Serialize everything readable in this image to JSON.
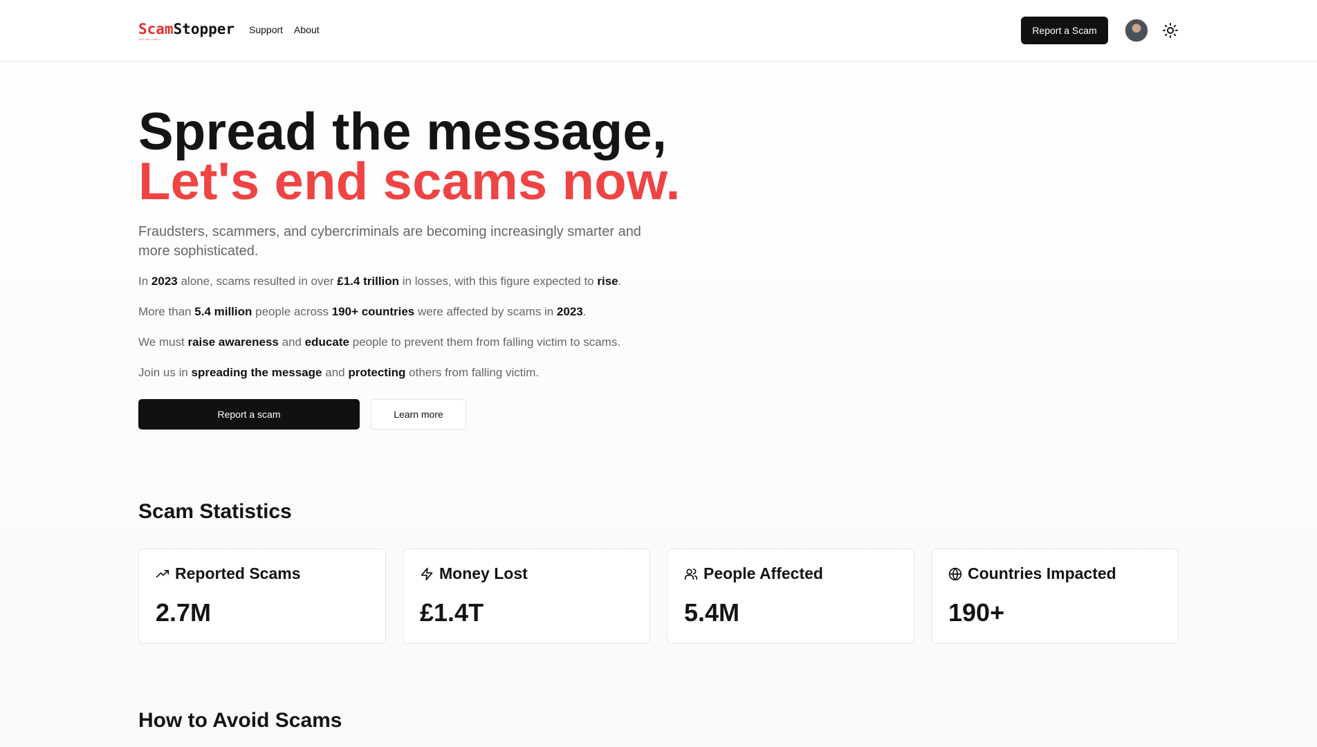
{
  "header": {
    "logo_part1": "Scam",
    "logo_part2": "Stopper",
    "logo_tagline": "Spot it. Stop it. Report it.",
    "nav": [
      {
        "label": "Support"
      },
      {
        "label": "About"
      }
    ],
    "report_button": "Report a Scam",
    "theme_icon": "sun-icon"
  },
  "hero": {
    "title_line1": "Spread the message,",
    "title_line2": "Let's end scams now.",
    "lead": "Fraudsters, scammers, and cybercriminals are becoming increasingly smarter and more sophisticated.",
    "p1": {
      "a": "In ",
      "b": "2023",
      "c": " alone, scams resulted in over ",
      "d": "£1.4 trillion",
      "e": " in losses, with this figure expected to ",
      "f": "rise",
      "g": "."
    },
    "p2": {
      "a": "More than ",
      "b": "5.4 million",
      "c": " people across ",
      "d": "190+ countries",
      "e": " were affected by scams in ",
      "f": "2023",
      "g": "."
    },
    "p3": {
      "a": "We must ",
      "b": "raise awareness",
      "c": " and ",
      "d": "educate",
      "e": " people to prevent them from falling victim to scams."
    },
    "p4": {
      "a": "Join us in ",
      "b": "spreading the message",
      "c": " and ",
      "d": "protecting",
      "e": " others from falling victim."
    },
    "primary_button": "Report a scam",
    "secondary_button": "Learn more"
  },
  "stats": {
    "title": "Scam Statistics",
    "cards": [
      {
        "label": "Reported Scams",
        "value": "2.7M",
        "icon": "trending-up-icon"
      },
      {
        "label": "Money Lost",
        "value": "£1.4T",
        "icon": "zap-icon"
      },
      {
        "label": "People Affected",
        "value": "5.4M",
        "icon": "users-icon"
      },
      {
        "label": "Countries Impacted",
        "value": "190+",
        "icon": "globe-icon"
      }
    ]
  },
  "avoid": {
    "title": "How to Avoid Scams"
  },
  "colors": {
    "accent": "#ef4444",
    "primary": "#111111"
  }
}
